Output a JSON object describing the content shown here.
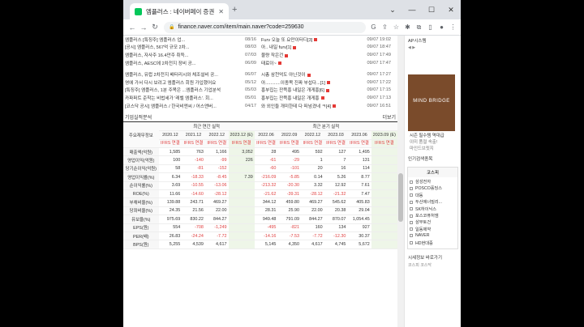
{
  "browser": {
    "tab_title": "엠플러스 : 네이버페이 증권",
    "url": "finance.naver.com/item/main.naver?code=259630"
  },
  "news": [
    {
      "title": "엠플러스 [특징주] 엠플러스 업...",
      "date": "08/16",
      "title2": "Furv 오늘 또 요만이터디[3]",
      "date2": "09/07 19:02"
    },
    {
      "title": "[공시] 엠플러스, 567억 규모 2차...",
      "date": "08/03",
      "title2": "아.. 내일 furv[1]",
      "date2": "09/07 18:47"
    },
    {
      "title": "엠플러스, 자사주 16.4만주 취득...",
      "date": "07/03",
      "title2": "물량 작은건",
      "date2": "09/07 17:49"
    },
    {
      "title": "엠플러스, AESC에 2차전지 장비 공...",
      "date": "06/09",
      "title2": "태료이~",
      "date2": "09/07 17:47"
    },
    {
      "title": "엠플러스, 유럽 2차전지 배터리시와 체조설비 공...",
      "date": "06/07",
      "title2": "시총 삼천억도 아닌것이",
      "date2": "09/07 17:27"
    },
    {
      "title": "영에 가서 다시 보려고 엠플러스 회원 가입했어요",
      "date": "05/12",
      "title2": "아............이종목 진짜 부섭다...[1]",
      "date2": "09/07 17:22"
    },
    {
      "title": "[특징주] 엠플러스, 1분 주목은 ...엠플러스 기업분석",
      "date": "05/03",
      "title2": "흥부집는 잔뜩흥 내일은 개게흥[6]",
      "date2": "09/07 17:15"
    },
    {
      "title": "카파퍼트 준착는 비법세가 '레벨 엠플러스'. 회...",
      "date": "05/01",
      "title2": "흥부집는 잔뜩흥 내일은 개게흥",
      "date2": "09/07 17:13"
    },
    {
      "title": "[코스닥 공시] 엠플러스 / 한국비엔씨 / 어스앤버...",
      "date": "04/17",
      "title2": "와 외인들 개미한테 다 떠넘겼네 ㅋ[4]",
      "date2": "09/07 16:51"
    }
  ],
  "section": {
    "title": "기업실적분석",
    "more": "더보기"
  },
  "table": {
    "label_col": "주요재무정보",
    "annual_header": "최근 연간 실적",
    "quarter_header": "최근 분기 실적",
    "periods": [
      "2020.12",
      "2021.12",
      "2022.12",
      "2023.12 (E)",
      "2022.06",
      "2022.09",
      "2022.12",
      "2023.03",
      "2023.06",
      "2023.09 (E)"
    ],
    "ifrs": "IFRS 연결",
    "rows": [
      {
        "name": "매출액(억원)",
        "values": [
          "1,585",
          "763",
          "1,166",
          "3,052",
          "28",
          "495",
          "592",
          "127",
          "1,495",
          ""
        ]
      },
      {
        "name": "영업이익(억원)",
        "values": [
          "100",
          "-140",
          "-99",
          "226",
          "-61",
          "-29",
          "1",
          "7",
          "131",
          ""
        ]
      },
      {
        "name": "당기순이익(억원)",
        "values": [
          "58",
          "-81",
          "-152",
          "",
          "-60",
          "-101",
          "20",
          "16",
          "114",
          ""
        ]
      },
      {
        "name": "영업이익률(%)",
        "values": [
          "6.34",
          "-18.33",
          "-8.45",
          "7.39",
          "-216.09",
          "-5.85",
          "0.14",
          "5.26",
          "8.77",
          ""
        ]
      },
      {
        "name": "순이익률(%)",
        "values": [
          "3.69",
          "-10.55",
          "-13.06",
          "",
          "-213.32",
          "-20.30",
          "3.32",
          "12.92",
          "7.61",
          ""
        ]
      },
      {
        "name": "ROE(%)",
        "values": [
          "11.66",
          "-14.60",
          "-28.12",
          "",
          "-21.62",
          "-39.31",
          "-28.12",
          "-21.32",
          "7.47",
          ""
        ]
      },
      {
        "name": "부채비율(%)",
        "values": [
          "139.88",
          "243.71",
          "469.27",
          "",
          "344.12",
          "459.80",
          "469.27",
          "545.62",
          "405.83",
          ""
        ]
      },
      {
        "name": "당좌비율(%)",
        "values": [
          "24.35",
          "21.56",
          "22.00",
          "",
          "28.31",
          "25.90",
          "22.00",
          "20.38",
          "29.04",
          ""
        ]
      },
      {
        "name": "유보율(%)",
        "values": [
          "975.69",
          "830.22",
          "844.27",
          "",
          "949.48",
          "791.09",
          "844.27",
          "870.07",
          "1,054.45",
          ""
        ]
      },
      {
        "name": "EPS(원)",
        "values": [
          "554",
          "-708",
          "-1,249",
          "",
          "-495",
          "-821",
          "160",
          "134",
          "927",
          ""
        ]
      },
      {
        "name": "PER(배)",
        "values": [
          "26.83",
          "-24.24",
          "-7.72",
          "",
          "-14.16",
          "-7.53",
          "-7.72",
          "-12.30",
          "30.37",
          ""
        ]
      },
      {
        "name": "BPS(원)",
        "values": [
          "5,255",
          "4,539",
          "4,617",
          "",
          "5,145",
          "4,350",
          "4,617",
          "4,745",
          "5,672",
          ""
        ]
      }
    ]
  },
  "side": {
    "title": "AP시스템",
    "ad_brand": "MIND BRIDGE",
    "ad_line1": "시즌 필수템 역대급",
    "ad_line2": "이미 품절 속출!",
    "ad_line3": "마인드브릿지",
    "popular_title": "인기검색종목",
    "tab": "코스피",
    "popular": [
      "삼성전자",
      "POSCO홀딩스",
      "대동",
      "두산에너빌리...",
      "SK하이닉스",
      "포스코퓨처엠",
      "삼부토건",
      "일동제약",
      "NAVER",
      "HD현대중"
    ],
    "footer": "시세정보 바로가기",
    "footer2": "코스피  코스닥"
  }
}
